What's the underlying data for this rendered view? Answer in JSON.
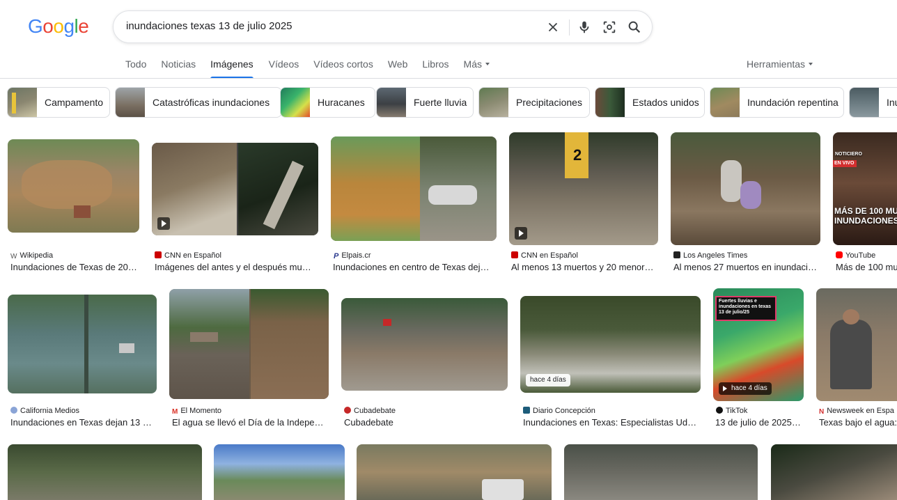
{
  "header": {
    "logo_letters": [
      "G",
      "o",
      "o",
      "g",
      "l",
      "e"
    ],
    "logo_colors": [
      "#4285F4",
      "#EA4335",
      "#FBBC05",
      "#4285F4",
      "#34A853",
      "#EA4335"
    ],
    "search_value": "inundaciones texas 13 de julio 2025",
    "icons": [
      "close-icon",
      "microphone-icon",
      "lens-icon",
      "search-icon"
    ]
  },
  "tabs": [
    {
      "label": "Todo",
      "active": false
    },
    {
      "label": "Noticias",
      "active": false
    },
    {
      "label": "Imágenes",
      "active": true
    },
    {
      "label": "Vídeos",
      "active": false
    },
    {
      "label": "Vídeos cortos",
      "active": false
    },
    {
      "label": "Web",
      "active": false
    },
    {
      "label": "Libros",
      "active": false
    },
    {
      "label": "Más",
      "active": false
    }
  ],
  "tools_label": "Herramientas",
  "chips": [
    {
      "label": "Campamento"
    },
    {
      "label": "Catastróficas inundaciones"
    },
    {
      "label": "Huracanes"
    },
    {
      "label": "Fuerte lluvia"
    },
    {
      "label": "Precipitaciones"
    },
    {
      "label": "Estados unidos"
    },
    {
      "label": "Inundación repentina"
    },
    {
      "label": "Inu"
    }
  ],
  "results": [
    {
      "source": "Wikipedia",
      "title": "Inundaciones de Texas de 20…",
      "fav_color": "#555555",
      "fav_glyph": "W"
    },
    {
      "source": "CNN en Español",
      "title": "Imágenes del antes y el después mu…",
      "fav_color": "#cc0000",
      "fav_glyph": ""
    },
    {
      "source": "Elpais.cr",
      "title": "Inundaciones en centro de Texas dej…",
      "fav_color": "#2b3a8f",
      "fav_glyph": "P"
    },
    {
      "source": "CNN en Español",
      "title": "Al menos 13 muertos y 20 menor…",
      "fav_color": "#cc0000",
      "fav_glyph": ""
    },
    {
      "source": "Los Angeles Times",
      "title": "Al menos 27 muertos en inundaci…",
      "fav_color": "#222222",
      "fav_glyph": ""
    },
    {
      "source": "YouTube",
      "title": "Más de 100 mu",
      "fav_color": "#ff0000",
      "fav_glyph": ""
    },
    {
      "source": "California Medios",
      "title": "Inundaciones en Texas dejan 13 …",
      "fav_color": "#8aa4d6",
      "fav_glyph": ""
    },
    {
      "source": "El Momento",
      "title": "El agua se llevó el Día de la Indepe…",
      "fav_color": "#d93025",
      "fav_glyph": "M"
    },
    {
      "source": "Cubadebate",
      "title": "Cubadebate",
      "fav_color": "#c62828",
      "fav_glyph": ""
    },
    {
      "source": "Diario Concepción",
      "title": "Inundaciones en Texas: Especialistas Ud…",
      "fav_color": "#1d5c7a",
      "fav_glyph": "D"
    },
    {
      "source": "TikTok",
      "title": "13 de julio de 2025…",
      "fav_color": "#111111",
      "fav_glyph": ""
    },
    {
      "source": "Newsweek en Espa",
      "title": "Texas bajo el agua:",
      "fav_color": "#d32f2f",
      "fav_glyph": "N"
    }
  ],
  "badges": {
    "gauge_label": "2",
    "overlay_youtube": "MÁS DE 100 MU\nINUNDACIONES",
    "overlay_youtube_small": "NOTICIERO",
    "live_label": "EN VIVO",
    "tiktok_overlay": "Fuertes lluvias e inundaciones en texas 13 de julio/25",
    "diario_badge": "hace 4 días",
    "tiktok_badge": "hace 4 días"
  }
}
